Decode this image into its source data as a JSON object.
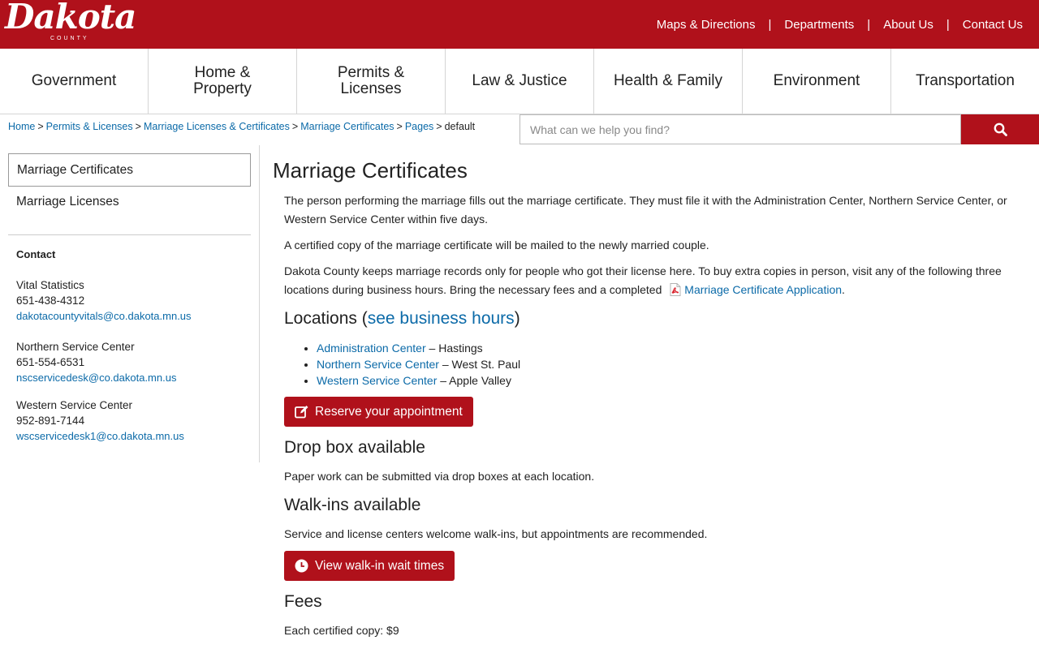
{
  "header": {
    "logo_text": "Dakota",
    "logo_sub": "COUNTY",
    "utility_links": [
      "Maps & Directions",
      "Departments",
      "About Us",
      "Contact Us"
    ],
    "brand_color": "#b0111b"
  },
  "nav": {
    "items": [
      "Government",
      "Home & Property",
      "Permits & Licenses",
      "Law & Justice",
      "Health & Family",
      "Environment",
      "Transportation"
    ]
  },
  "breadcrumb": {
    "links": [
      "Home",
      "Permits & Licenses",
      "Marriage Licenses & Certificates",
      "Marriage Certificates",
      "Pages"
    ],
    "current": "default",
    "separator": ">"
  },
  "search": {
    "placeholder": "What can we help you find?",
    "icon": "search-icon"
  },
  "sidebar": {
    "active_item": "Marriage Certificates",
    "items": [
      "Marriage Licenses"
    ],
    "contact_heading": "Contact",
    "contacts": [
      {
        "name": "Vital Statistics",
        "phone": "651-438-4312",
        "email": "dakotacountyvitals@co.dakota.mn.us"
      },
      {
        "name": "Northern Service Center",
        "phone": "651-554-6531",
        "email": "nscservicedesk@co.dakota.mn.us"
      },
      {
        "name": "Western Service Center",
        "phone": "952-891-7144",
        "email": "wscservicedesk1@co.dakota.mn.us"
      }
    ]
  },
  "main": {
    "title": "Marriage Certificates",
    "p1": "The person performing the marriage fills out the marriage certificate. They must file it with the Administration Center, Northern Service Center, or Western Service Center within five days.",
    "p2": "A certified copy of the marriage certificate will be mailed to the newly married couple.",
    "p3_text": "Dakota County keeps marriage records only for people who got their license here. To buy extra copies in person, visit any of the following three locations during business hours. Bring the necessary fees and a completed",
    "p3_link": "Marriage Certificate Application",
    "p3_end": ".",
    "locations_heading": "Locations (",
    "locations_link": "see business hours",
    "locations_close": ")",
    "locations": [
      {
        "name": "Administration Center",
        "city": "Hastings"
      },
      {
        "name": "Northern Service Center",
        "city": "West St. Paul"
      },
      {
        "name": "Western Service Center",
        "city": "Apple Valley"
      }
    ],
    "location_dash": " – ",
    "reserve_button": "Reserve your appointment",
    "dropbox_heading": "Drop box available",
    "dropbox_text": "Paper work can be submitted via drop boxes at each location.",
    "walkins_heading": "Walk-ins available",
    "walkins_text": "Service and license centers welcome walk-ins, but appointments are recommended.",
    "walkin_button": "View walk-in wait times",
    "fees_heading": "Fees",
    "fees_text": "Each certified copy: $9"
  }
}
